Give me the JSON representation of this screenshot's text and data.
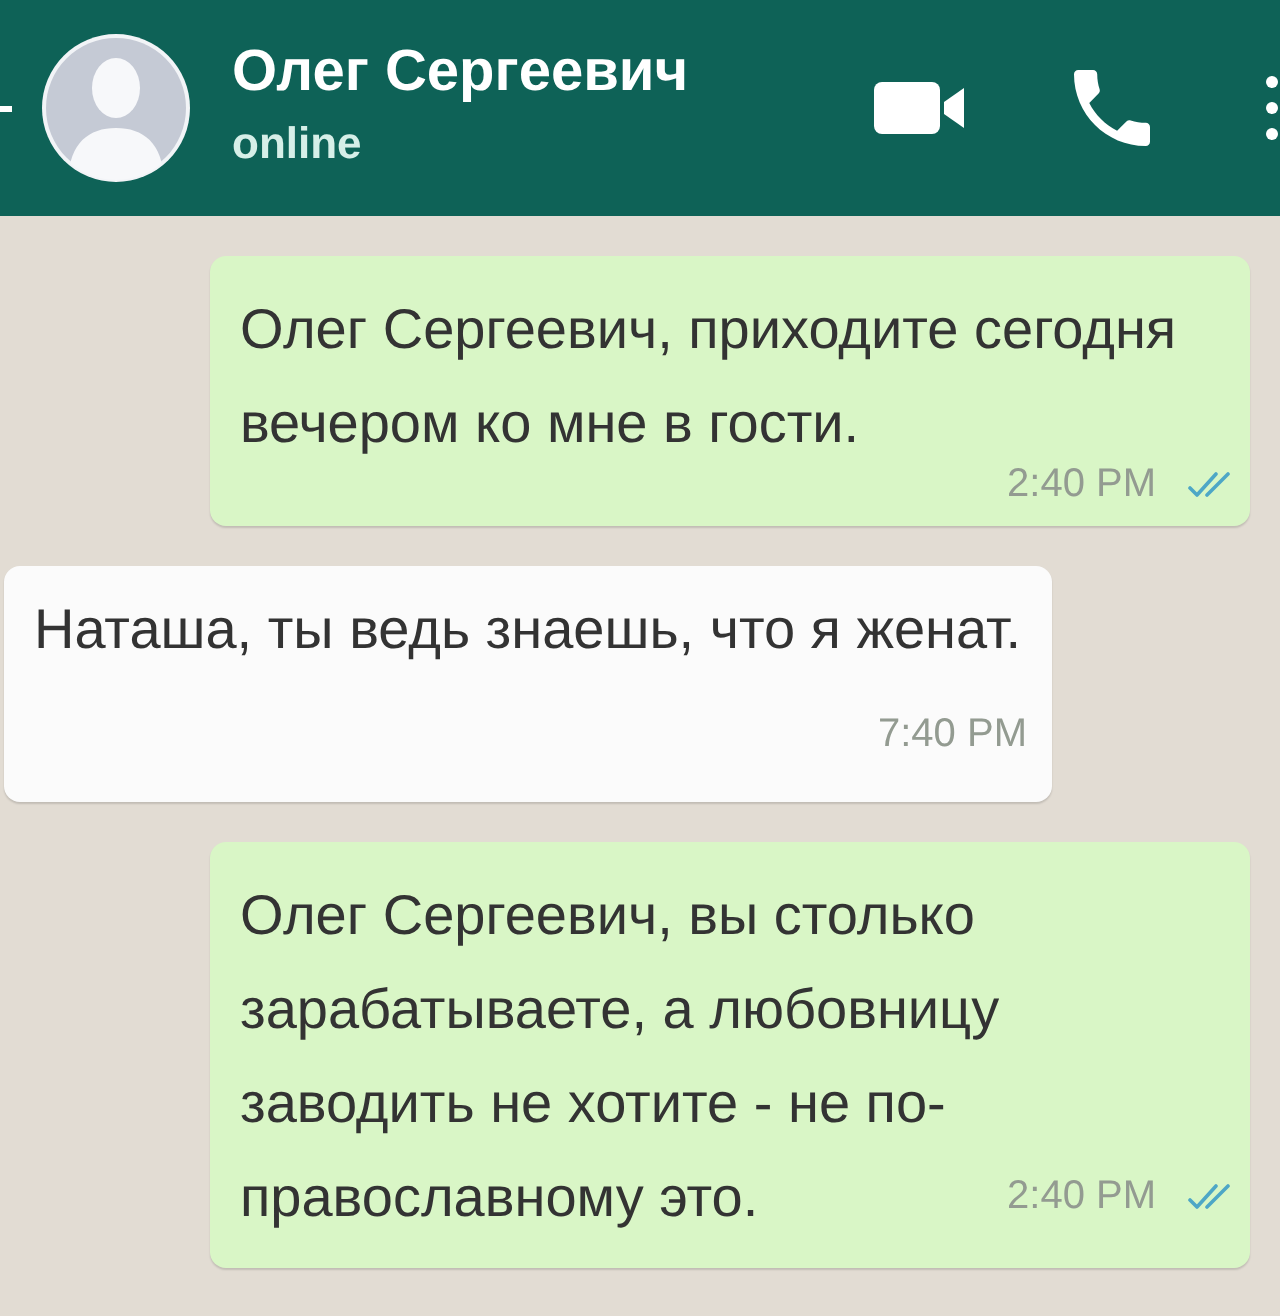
{
  "header": {
    "contact_name": "Олег Сергеевич",
    "status": "online"
  },
  "messages": [
    {
      "kind": "outgoing",
      "text": "Олег Сергеевич, приходите сегодня вечером ко мне в гости.",
      "time": "2:40 PM",
      "read": true
    },
    {
      "kind": "incoming",
      "text": "Наташа, ты ведь знаешь, что я женат.",
      "time": "7:40 PM"
    },
    {
      "kind": "outgoing",
      "text": "Олег Сергеевич, вы столько зарабатываете, а любовницу заводить не хотите - не по-православному это.",
      "time": "2:40 PM",
      "read": true
    }
  ]
}
